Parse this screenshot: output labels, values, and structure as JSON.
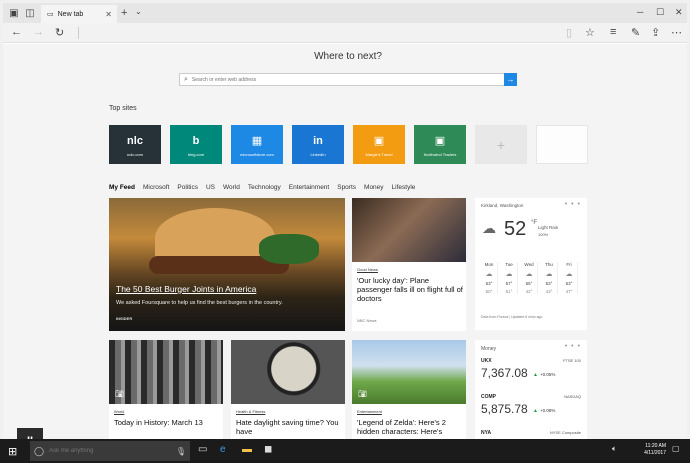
{
  "browser": {
    "tab_title": "New tab",
    "new_tab_glyph": "+",
    "tab_menu_glyph": "⌄",
    "accent_color": "#1e88e5"
  },
  "newtab": {
    "heading": "Where to next?",
    "search_placeholder": "Search or enter web address",
    "top_sites_label": "Top sites",
    "top_sites": [
      {
        "name": "nolc.com",
        "logo": "nlc",
        "color": "#263238"
      },
      {
        "name": "bing.com",
        "logo": "b",
        "color": "#00897b"
      },
      {
        "name": "microsoftstore.com",
        "logo": "▦",
        "color": "#1e88e5"
      },
      {
        "name": "LinkedIn",
        "logo": "in",
        "color": "#1976d2"
      },
      {
        "name": "Margie's Travel",
        "logo": "▣",
        "color": "#f39c12"
      },
      {
        "name": "Northwind Traders",
        "logo": "▣",
        "color": "#2e8b57"
      },
      {
        "name": "+",
        "logo": "",
        "color": "#e8e8e8"
      }
    ],
    "feed_tabs": [
      "My Feed",
      "Microsoft",
      "Politics",
      "US",
      "World",
      "Technology",
      "Entertainment",
      "Sports",
      "Money",
      "Lifestyle"
    ]
  },
  "feed": {
    "hero": {
      "title": "The 50 Best Burger Joints in America",
      "description": "We asked Foursquare to help us find the best burgers in the country.",
      "source": "INSIDER"
    },
    "card2": {
      "tag": "Good News",
      "title": "'Our lucky day': Plane passenger falls ill on flight full of doctors",
      "source": "NBC News"
    },
    "bottom": [
      {
        "tag": "World",
        "title": "Today in History: March 13"
      },
      {
        "tag": "Health & Fitness",
        "title": "Hate daylight saving time? You have"
      },
      {
        "tag": "Entertainment",
        "title": "'Legend of Zelda': Here's 2 hidden characters: Here's"
      }
    ]
  },
  "weather": {
    "location": "Kirkland, Washington",
    "more": "• • •",
    "temp": "52",
    "unit": "°F",
    "condition": "Light Rain",
    "precip": "100%",
    "days": [
      {
        "d": "Mon",
        "hi": "53°",
        "lo": "50°"
      },
      {
        "d": "Tue",
        "hi": "57°",
        "lo": "51°"
      },
      {
        "d": "Wed",
        "hi": "55°",
        "lo": "42°"
      },
      {
        "d": "Thu",
        "hi": "53°",
        "lo": "43°"
      },
      {
        "d": "Fri",
        "hi": "53°",
        "lo": "47°"
      }
    ],
    "updated": "Data from Foreca | Updated 6 mins ago"
  },
  "money": {
    "title": "Money",
    "more": "• • •",
    "stocks": [
      {
        "sym": "UKX",
        "ex": "FTSE 100",
        "val": "7,367.08",
        "chg": "+0.05%"
      },
      {
        "sym": "COMP",
        "ex": "NASDAQ",
        "val": "5,875.78",
        "chg": "+0.08%"
      },
      {
        "sym": "NYA",
        "ex": "NYSE Composite",
        "val": "",
        "chg": ""
      }
    ],
    "up_color": "#1a9e4a"
  },
  "taskbar": {
    "cortana_placeholder": "Ask me anything",
    "time": "11:20 AM",
    "date": "4/11/2017",
    "pause_glyph": "II"
  }
}
